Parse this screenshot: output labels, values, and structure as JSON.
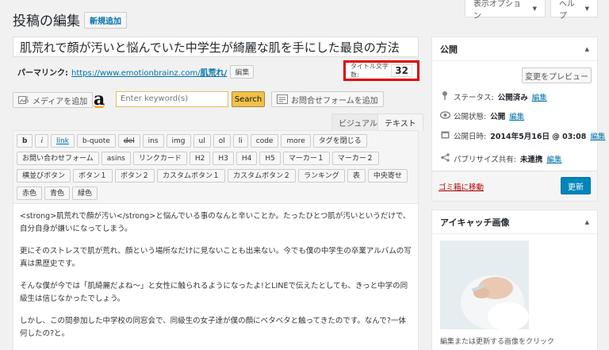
{
  "header": {
    "title": "投稿の編集",
    "new_button": "新規追加",
    "screen_options": "表示オプション",
    "help": "ヘルプ"
  },
  "post": {
    "title": "肌荒れで顔が汚いと悩んでいた中学生が綺麗な肌を手にした最良の方法",
    "permalink_label": "パーマリンク:",
    "permalink_base": "https://www.emotionbrainz.com/",
    "permalink_slug": "肌荒れ/",
    "permalink_edit": "編集",
    "title_count_label": "タイトル文字数:",
    "title_count": "32"
  },
  "media": {
    "add_media": "メディアを追加",
    "amazon_logo": "a",
    "keyword_placeholder": "Enter keyword(s)",
    "search": "Search",
    "add_form": "お問合せフォームを追加"
  },
  "editor": {
    "tab_visual": "ビジュアル",
    "tab_text": "テキスト",
    "toolbar_rows": [
      [
        "b",
        "i",
        "link",
        "b-quote",
        "del",
        "ins",
        "img",
        "ul",
        "ol",
        "li",
        "code",
        "more",
        "タグを閉じる"
      ],
      [
        "お問い合わせフォーム",
        "asins",
        "リンクカード",
        "H2",
        "H3",
        "H4",
        "H5",
        "マーカー１",
        "マーカー２"
      ],
      [
        "横並びボタン",
        "ボタン１",
        "ボタン２",
        "カスタムボタン１",
        "カスタムボタン２",
        "ランキング",
        "表",
        "中央寄せ"
      ],
      [
        "赤色",
        "青色",
        "緑色"
      ]
    ],
    "paragraphs": [
      "<strong>肌荒れで顔が汚い</strong>と悩んでいる事のなんと辛いことか。たったひとつ肌が汚いというだけで、自分自身が嫌いになってしまう。",
      "更にそのストレスで肌が荒れ、顔という場所なだけに見ないことも出来ない。今でも僕の中学生の卒業アルバムの写真は黒歴史です。",
      "そんな僕が今では「肌綺麗だよね〜」と女性に触られるようになったよ!とLINEで伝えたとしても、きっと中学の同級生は信じなかったでしょう。",
      "しかし、この間参加した中学校の同窓会で、同級生の女子達が僕の顔にベタベタと触ってきたのです。なんで?一体何したの?と。"
    ]
  },
  "publish": {
    "title": "公開",
    "preview": "変更をプレビュー",
    "status_label": "ステータス:",
    "status_value": "公開済み",
    "visibility_label": "公開状態:",
    "visibility_value": "公開",
    "date_label": "公開日時:",
    "date_value": "2014年5月16日 @ 03:08",
    "share_label": "パブリサイズ共有:",
    "share_value": "未連携",
    "edit": "編集",
    "trash": "ゴミ箱に移動",
    "update": "更新"
  },
  "eyecatch": {
    "title": "アイキャッチ画像",
    "caption": "編集または更新する画像をクリック"
  }
}
